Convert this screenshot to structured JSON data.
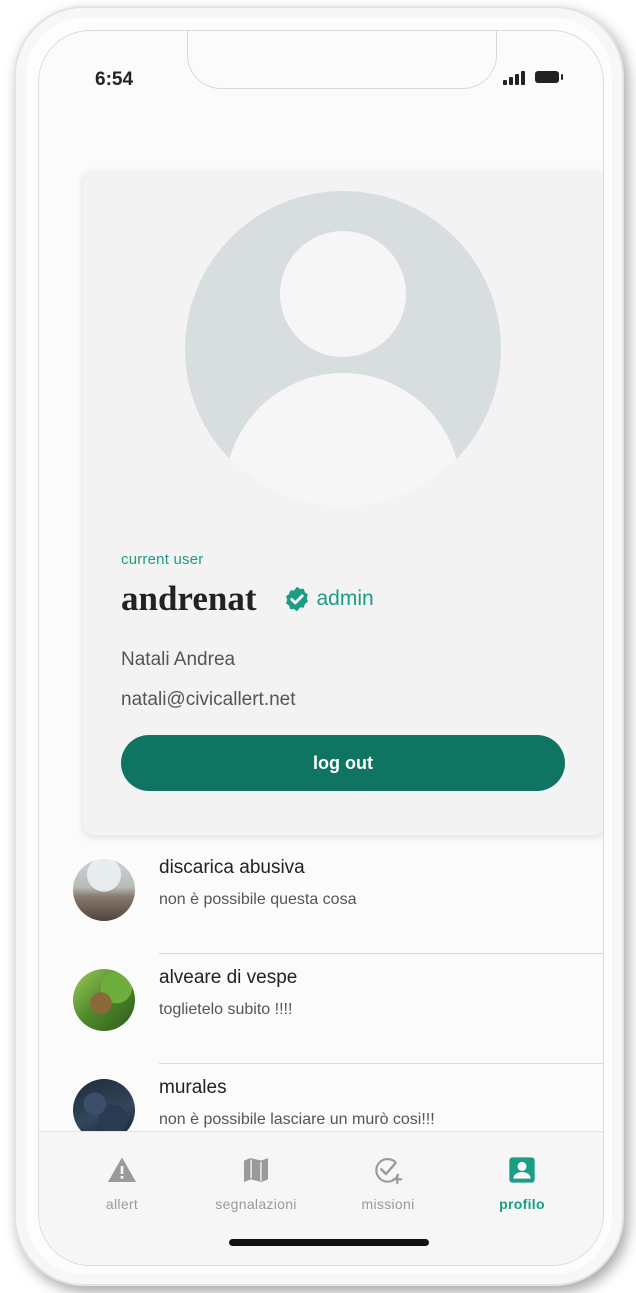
{
  "status_bar": {
    "time": "6:54"
  },
  "profile": {
    "label": "current user",
    "username": "andrenat",
    "role": "admin",
    "full_name": "Natali Andrea",
    "email": "natali@civicallert.net",
    "logout_label": "log out"
  },
  "reports": [
    {
      "title": "discarica abusiva",
      "subtitle": "non è possibile questa cosa",
      "thumbnail": "landfill-photo"
    },
    {
      "title": "alveare di vespe",
      "subtitle": "toglietelo subito !!!!",
      "thumbnail": "wasp-nest-photo"
    },
    {
      "title": "murales",
      "subtitle": "non è possibile lasciare un murò cosi!!!",
      "thumbnail": "mural-photo"
    }
  ],
  "tabs": [
    {
      "label": "allert",
      "icon": "warning-icon",
      "active": false
    },
    {
      "label": "segnalazioni",
      "icon": "map-icon",
      "active": false
    },
    {
      "label": "missioni",
      "icon": "check-add-icon",
      "active": false
    },
    {
      "label": "profilo",
      "icon": "profile-badge-icon",
      "active": true
    }
  ],
  "colors": {
    "accent": "#1a9c85",
    "button": "#0f7461",
    "inactive_tab": "#9a9a9a"
  }
}
